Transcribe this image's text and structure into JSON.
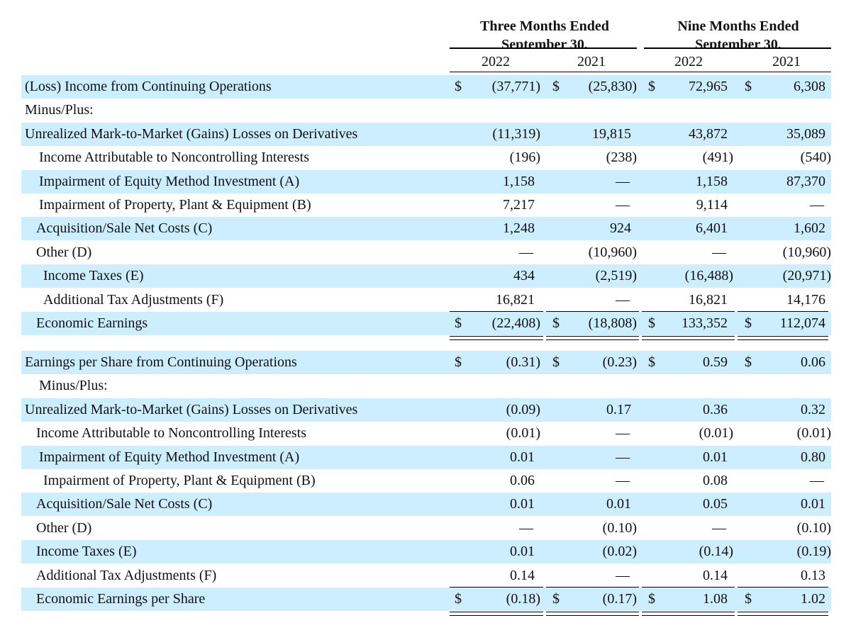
{
  "headers": {
    "three_months": "Three Months Ended",
    "three_months_date": "September 30,",
    "nine_months": "Nine Months Ended",
    "nine_months_date": "September 30,",
    "years": [
      "2022",
      "2021",
      "2022",
      "2021"
    ]
  },
  "colors": {
    "shade": "#cceeff",
    "text": "#111111"
  },
  "sections": [
    {
      "rows": [
        {
          "label": "(Loss) Income from Continuing Operations",
          "indent": 0,
          "shaded": true,
          "dollar": true,
          "values": [
            "(37,771)",
            "(25,830)",
            "72,965",
            "6,308"
          ]
        },
        {
          "label": "Minus/Plus:",
          "indent": 0,
          "shaded": false,
          "dollar": false,
          "values": [
            "",
            "",
            "",
            ""
          ]
        },
        {
          "label": "Unrealized Mark-to-Market (Gains) Losses on Derivatives",
          "indent": 0,
          "shaded": true,
          "dollar": false,
          "values": [
            "(11,319)",
            "19,815",
            "43,872",
            "35,089"
          ]
        },
        {
          "label": "Income Attributable to Noncontrolling Interests",
          "indent": 20,
          "shaded": false,
          "dollar": false,
          "values": [
            "(196)",
            "(238)",
            "(491)",
            "(540)"
          ]
        },
        {
          "label": "Impairment of Equity Method Investment (A)",
          "indent": 20,
          "shaded": true,
          "dollar": false,
          "values": [
            "1,158",
            "—",
            "1,158",
            "87,370"
          ]
        },
        {
          "label": "Impairment of Property, Plant & Equipment (B)",
          "indent": 20,
          "shaded": false,
          "dollar": false,
          "values": [
            "7,217",
            "—",
            "9,114",
            "—"
          ]
        },
        {
          "label": "Acquisition/Sale Net Costs (C)",
          "indent": 16,
          "shaded": true,
          "dollar": false,
          "values": [
            "1,248",
            "924",
            "6,401",
            "1,602"
          ]
        },
        {
          "label": "Other (D)",
          "indent": 16,
          "shaded": false,
          "dollar": false,
          "values": [
            "—",
            "(10,960)",
            "—",
            "(10,960)"
          ]
        },
        {
          "label": "Income Taxes (E)",
          "indent": 26,
          "shaded": true,
          "dollar": false,
          "values": [
            "434",
            "(2,519)",
            "(16,488)",
            "(20,971)"
          ]
        },
        {
          "label": "Additional Tax Adjustments (F)",
          "indent": 26,
          "shaded": false,
          "dollar": false,
          "values": [
            "16,821",
            "—",
            "16,821",
            "14,176"
          ]
        },
        {
          "label": "Economic Earnings",
          "indent": 16,
          "shaded": true,
          "dollar": true,
          "total": true,
          "values": [
            "(22,408)",
            "(18,808)",
            "133,352",
            "112,074"
          ]
        }
      ]
    },
    {
      "rows": [
        {
          "label": "Earnings per Share from Continuing Operations",
          "indent": 0,
          "shaded": true,
          "dollar": true,
          "values": [
            "(0.31)",
            "(0.23)",
            "0.59",
            "0.06"
          ]
        },
        {
          "label": "Minus/Plus:",
          "indent": 20,
          "shaded": false,
          "dollar": false,
          "values": [
            "",
            "",
            "",
            ""
          ]
        },
        {
          "label": "Unrealized Mark-to-Market (Gains) Losses on Derivatives",
          "indent": 0,
          "shaded": true,
          "dollar": false,
          "values": [
            "(0.09)",
            "0.17",
            "0.36",
            "0.32"
          ]
        },
        {
          "label": "Income Attributable to Noncontrolling Interests",
          "indent": 16,
          "shaded": false,
          "dollar": false,
          "values": [
            "(0.01)",
            "—",
            "(0.01)",
            "(0.01)"
          ]
        },
        {
          "label": "Impairment of Equity Method Investment (A)",
          "indent": 20,
          "shaded": true,
          "dollar": false,
          "values": [
            "0.01",
            "—",
            "0.01",
            "0.80"
          ]
        },
        {
          "label": "Impairment of Property, Plant & Equipment (B)",
          "indent": 26,
          "shaded": false,
          "dollar": false,
          "values": [
            "0.06",
            "—",
            "0.08",
            "—"
          ]
        },
        {
          "label": "Acquisition/Sale Net Costs (C)",
          "indent": 16,
          "shaded": true,
          "dollar": false,
          "values": [
            "0.01",
            "0.01",
            "0.05",
            "0.01"
          ]
        },
        {
          "label": "Other (D)",
          "indent": 16,
          "shaded": false,
          "dollar": false,
          "values": [
            "—",
            "(0.10)",
            "—",
            "(0.10)"
          ]
        },
        {
          "label": "Income Taxes (E)",
          "indent": 16,
          "shaded": true,
          "dollar": false,
          "values": [
            "0.01",
            "(0.02)",
            "(0.14)",
            "(0.19)"
          ]
        },
        {
          "label": "Additional Tax Adjustments (F)",
          "indent": 16,
          "shaded": false,
          "dollar": false,
          "values": [
            "0.14",
            "—",
            "0.14",
            "0.13"
          ]
        },
        {
          "label": "Economic Earnings per Share",
          "indent": 16,
          "shaded": true,
          "dollar": true,
          "total": true,
          "values": [
            "(0.18)",
            "(0.17)",
            "1.08",
            "1.02"
          ]
        }
      ]
    }
  ],
  "dollar_sign": "$"
}
